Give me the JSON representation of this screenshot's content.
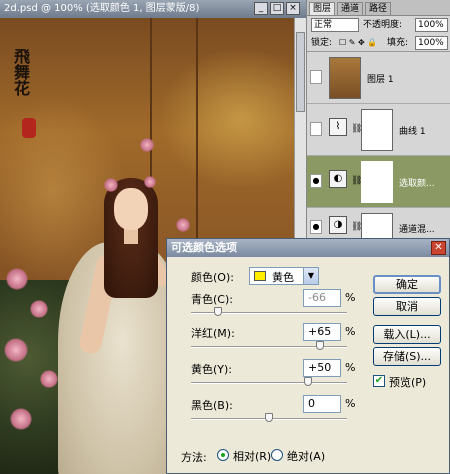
{
  "document": {
    "title": "2d.psd @ 100% (选取颜色 1, 图层蒙版/8)",
    "calligraphy": "飛舞花",
    "minimize_glyph": "_",
    "maximize_glyph": "□",
    "close_glyph": "×"
  },
  "layers_panel": {
    "tabs": [
      "图层",
      "通道",
      "路径"
    ],
    "blend_mode": "正常",
    "opacity_label": "不透明度:",
    "opacity_value": "100%",
    "lock_label": "锁定:",
    "fill_label": "填充:",
    "fill_value": "100%",
    "layers": [
      {
        "name": "图层 1",
        "visible": false,
        "kind": "photo"
      },
      {
        "name": "曲线 1",
        "visible": false,
        "kind": "curves"
      },
      {
        "name": "选取颜...",
        "visible": true,
        "kind": "selective-color",
        "selected": true
      },
      {
        "name": "通道混...",
        "visible": true,
        "kind": "channel-mixer"
      }
    ]
  },
  "dialog": {
    "title": "可选颜色选项",
    "colors_label": "颜色(O):",
    "colors_value": "黄色",
    "swatch_color": "#ffee00",
    "sliders": [
      {
        "label": "青色(C):",
        "value": "-66",
        "level": -66,
        "dim": true
      },
      {
        "label": "洋红(M):",
        "value": "+65",
        "level": 65,
        "dim": false
      },
      {
        "label": "黄色(Y):",
        "value": "+50",
        "level": 50,
        "dim": false
      },
      {
        "label": "黑色(B):",
        "value": "0",
        "level": 0,
        "dim": false
      }
    ],
    "percent_sign": "%",
    "buttons": {
      "ok": "确定",
      "cancel": "取消",
      "load": "载入(L)...",
      "save": "存储(S)..."
    },
    "preview_label": "预览(P)",
    "preview_checked": true,
    "method_label": "方法:",
    "method_relative": "相对(R)",
    "method_absolute": "绝对(A)",
    "method_selected": "relative"
  }
}
